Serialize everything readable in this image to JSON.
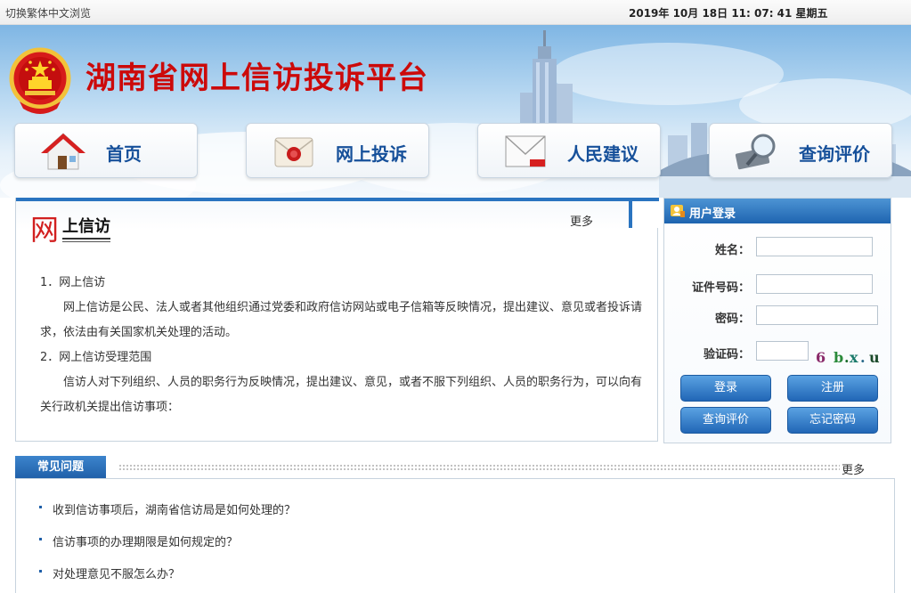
{
  "topbar": {
    "switch_label": "切换繁体中文浏览",
    "datetime": "2019年 10月 18日 11: 07: 41 星期五"
  },
  "header": {
    "site_title": "湖南省网上信访投诉平台"
  },
  "nav": [
    {
      "label": "首页",
      "icon": "house-icon"
    },
    {
      "label": "网上投诉",
      "icon": "envelope-seal-icon"
    },
    {
      "label": "人民建议",
      "icon": "mail-icon"
    },
    {
      "label": "查询评价",
      "icon": "magnifier-icon"
    }
  ],
  "info_panel": {
    "title_char": "网",
    "title_rest": "上信访",
    "more_label": "更多",
    "paragraphs": [
      "1．网上信访",
      "网上信访是公民、法人或者其他组织通过党委和政府信访网站或电子信箱等反映情况，提出建议、意见或者投诉请求，依法由有关国家机关处理的活动。",
      "2．网上信访受理范围",
      "信访人对下列组织、人员的职务行为反映情况，提出建议、意见，或者不服下列组织、人员的职务行为，可以向有关行政机关提出信访事项："
    ]
  },
  "login": {
    "title": "用户登录",
    "name_label": "姓名：",
    "id_label": "证件号码：",
    "password_label": "密码：",
    "captcha_label": "验证码：",
    "captcha_text": [
      "6",
      "b",
      ".",
      "x",
      ".",
      "u"
    ],
    "buttons": {
      "login": "登录",
      "register": "注册",
      "query": "查询评价",
      "forgot": "忘记密码"
    }
  },
  "faq": {
    "tab_label": "常见问题",
    "more_label": "更多",
    "items": [
      "收到信访事项后，湖南省信访局是如何处理的？",
      "信访事项的办理期限是如何规定的？",
      "对处理意见不服怎么办？"
    ]
  },
  "colors": {
    "title_red": "#cc0a0a",
    "nav_blue": "#16509a",
    "accent_blue": "#2a74c0"
  }
}
